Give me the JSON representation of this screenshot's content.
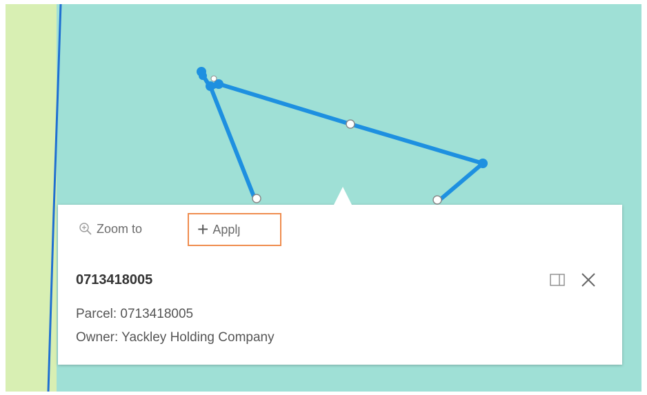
{
  "map": {
    "water_color": "#9fe0d6",
    "land_color": "#d8efb3",
    "sketch_color": "#1e90e0"
  },
  "popup": {
    "actions": {
      "zoom_to_label": "Zoom to",
      "apply_label": "Applȷ",
      "zoom_icon": "magnifier-zoom-icon",
      "apply_icon": "plus-icon"
    },
    "title": "0713418005",
    "fields": {
      "parcel": "Parcel: 0713418005",
      "owner": "Owner: Yackley Holding Company"
    },
    "controls": {
      "dock_icon": "dock-icon",
      "close_icon": "close-icon"
    },
    "highlight_color": "#ef8c4e"
  }
}
